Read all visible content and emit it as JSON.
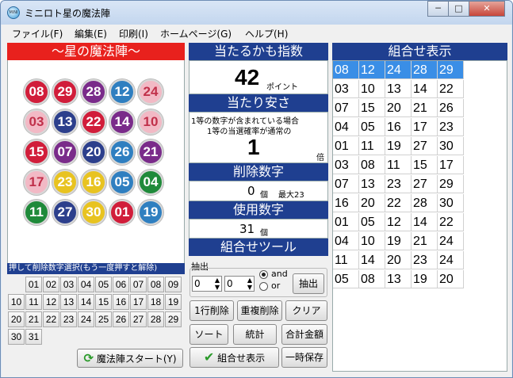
{
  "window": {
    "title": "ミニロト星の魔法陣",
    "icon_label": "MINI"
  },
  "menu": [
    "ファイル(F)",
    "編集(E)",
    "印刷(I)",
    "ホームページ(G)",
    "ヘルプ(H)"
  ],
  "left": {
    "title": "～星の魔法陣～",
    "balls": [
      {
        "n": "08",
        "color": "#d11d3a"
      },
      {
        "n": "29",
        "color": "#d11d3a"
      },
      {
        "n": "28",
        "color": "#7a2b8a"
      },
      {
        "n": "12",
        "color": "#2f7fc0"
      },
      {
        "n": "24",
        "color": "#f2b9c5"
      },
      {
        "n": "03",
        "color": "#f2b9c5"
      },
      {
        "n": "13",
        "color": "#2c3f8c"
      },
      {
        "n": "22",
        "color": "#d11d3a"
      },
      {
        "n": "14",
        "color": "#7a2b8a"
      },
      {
        "n": "10",
        "color": "#f2b9c5"
      },
      {
        "n": "15",
        "color": "#d11d3a"
      },
      {
        "n": "07",
        "color": "#7a2b8a"
      },
      {
        "n": "20",
        "color": "#2c3f8c"
      },
      {
        "n": "26",
        "color": "#2f7fc0"
      },
      {
        "n": "21",
        "color": "#7a2b8a"
      },
      {
        "n": "17",
        "color": "#f2b9c5"
      },
      {
        "n": "23",
        "color": "#e8c320"
      },
      {
        "n": "16",
        "color": "#e8c320"
      },
      {
        "n": "05",
        "color": "#2f7fc0"
      },
      {
        "n": "04",
        "color": "#1f8a3a"
      },
      {
        "n": "11",
        "color": "#1f8a3a"
      },
      {
        "n": "27",
        "color": "#2c3f8c"
      },
      {
        "n": "30",
        "color": "#e8c320"
      },
      {
        "n": "01",
        "color": "#d11d3a"
      },
      {
        "n": "19",
        "color": "#2f7fc0"
      }
    ],
    "number_header": "押して削除数字選択(もう一度押すと解除)",
    "numbers": [
      "01",
      "02",
      "03",
      "04",
      "05",
      "06",
      "07",
      "08",
      "09",
      "10",
      "11",
      "12",
      "13",
      "14",
      "15",
      "16",
      "17",
      "18",
      "19",
      "20",
      "21",
      "22",
      "23",
      "24",
      "25",
      "26",
      "27",
      "28",
      "29",
      "30",
      "31"
    ],
    "start_button": "魔法陣スタート(Y)"
  },
  "middle": {
    "hit_index_title": "当たるかも指数",
    "hit_index_value": "42",
    "hit_index_unit": "ポイント",
    "ease_title": "当たり安さ",
    "ease_line1": "1等の数字が含まれている場合",
    "ease_line2": "1等の当選確率が通常の",
    "ease_value": "1",
    "ease_unit": "倍",
    "delete_title": "削除数字",
    "delete_value": "0",
    "delete_unit": "個",
    "delete_max": "最大23",
    "use_title": "使用数字",
    "use_value": "31",
    "use_unit": "個",
    "tool_title": "組合せツール",
    "extract_label": "抽出",
    "spin1": "0",
    "spin2": "0",
    "radio_and": "and",
    "radio_or": "or",
    "extract_button": "抽出",
    "buttons": {
      "row_delete": "1行削除",
      "dup_delete": "重複削除",
      "clear": "クリア",
      "sort": "ソート",
      "stats": "統計",
      "total": "合計金額",
      "show_combo": "組合せ表示",
      "temp_save": "一時保存"
    }
  },
  "right": {
    "title": "組合せ表示",
    "rows": [
      [
        "08",
        "12",
        "24",
        "28",
        "29"
      ],
      [
        "03",
        "10",
        "13",
        "14",
        "22"
      ],
      [
        "07",
        "15",
        "20",
        "21",
        "26"
      ],
      [
        "04",
        "05",
        "16",
        "17",
        "23"
      ],
      [
        "01",
        "11",
        "19",
        "27",
        "30"
      ],
      [
        "03",
        "08",
        "11",
        "15",
        "17"
      ],
      [
        "07",
        "13",
        "23",
        "27",
        "29"
      ],
      [
        "16",
        "20",
        "22",
        "28",
        "30"
      ],
      [
        "01",
        "05",
        "12",
        "14",
        "22"
      ],
      [
        "04",
        "10",
        "19",
        "21",
        "24"
      ],
      [
        "11",
        "14",
        "20",
        "23",
        "24"
      ],
      [
        "05",
        "08",
        "13",
        "19",
        "20"
      ]
    ]
  }
}
